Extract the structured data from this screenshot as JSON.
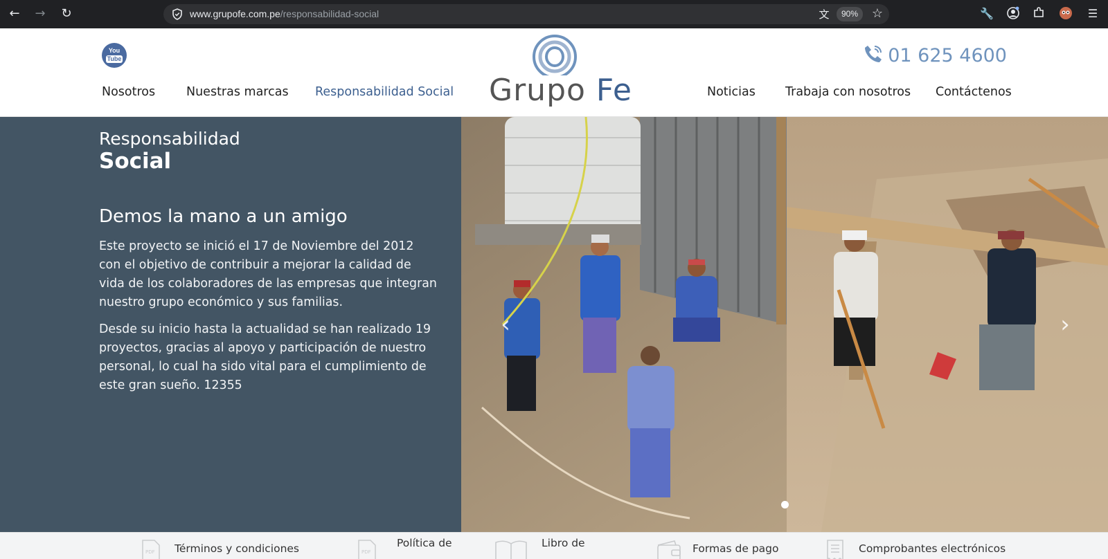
{
  "browser": {
    "url_domain": "www.grupofe.com.pe",
    "url_path": "/responsabilidad-social",
    "zoom": "90%"
  },
  "header": {
    "youtube_icon_text_top": "You",
    "youtube_icon_text_bottom": "Tube",
    "phone": "01 625 4600",
    "logo_word": "Grupo",
    "logo_word_accent": "Fe",
    "menu": {
      "nosotros": "Nosotros",
      "marcas": "Nuestras marcas",
      "responsabilidad": "Responsabilidad Social",
      "noticias": "Noticias",
      "trabaja": "Trabaja con nosotros",
      "contacto": "Contáctenos"
    }
  },
  "content": {
    "title_line1": "Responsabilidad",
    "title_line2": "Social",
    "heading": "Demos la mano a un amigo",
    "paragraph1": "Este proyecto se inició el 17 de Noviembre del 2012 con el objetivo de contribuir a mejorar la calidad de vida de los colaboradores de las empresas que integran nuestro grupo económico y sus familias.",
    "paragraph2": "Desde su inicio hasta la actualidad se han realizado 19 proyectos, gracias al apoyo y participación de nuestro personal, lo cual ha sido vital para el cumplimiento de este gran sueño. 12355"
  },
  "carousel": {
    "prev": "‹",
    "next": "›"
  },
  "footer": {
    "terminos": "Términos y condiciones",
    "politica": "Política de",
    "libro": "Libro de",
    "formas": "Formas de pago",
    "comprobantes": "Comprobantes electrónicos",
    "pdf_badge": "PDF"
  }
}
